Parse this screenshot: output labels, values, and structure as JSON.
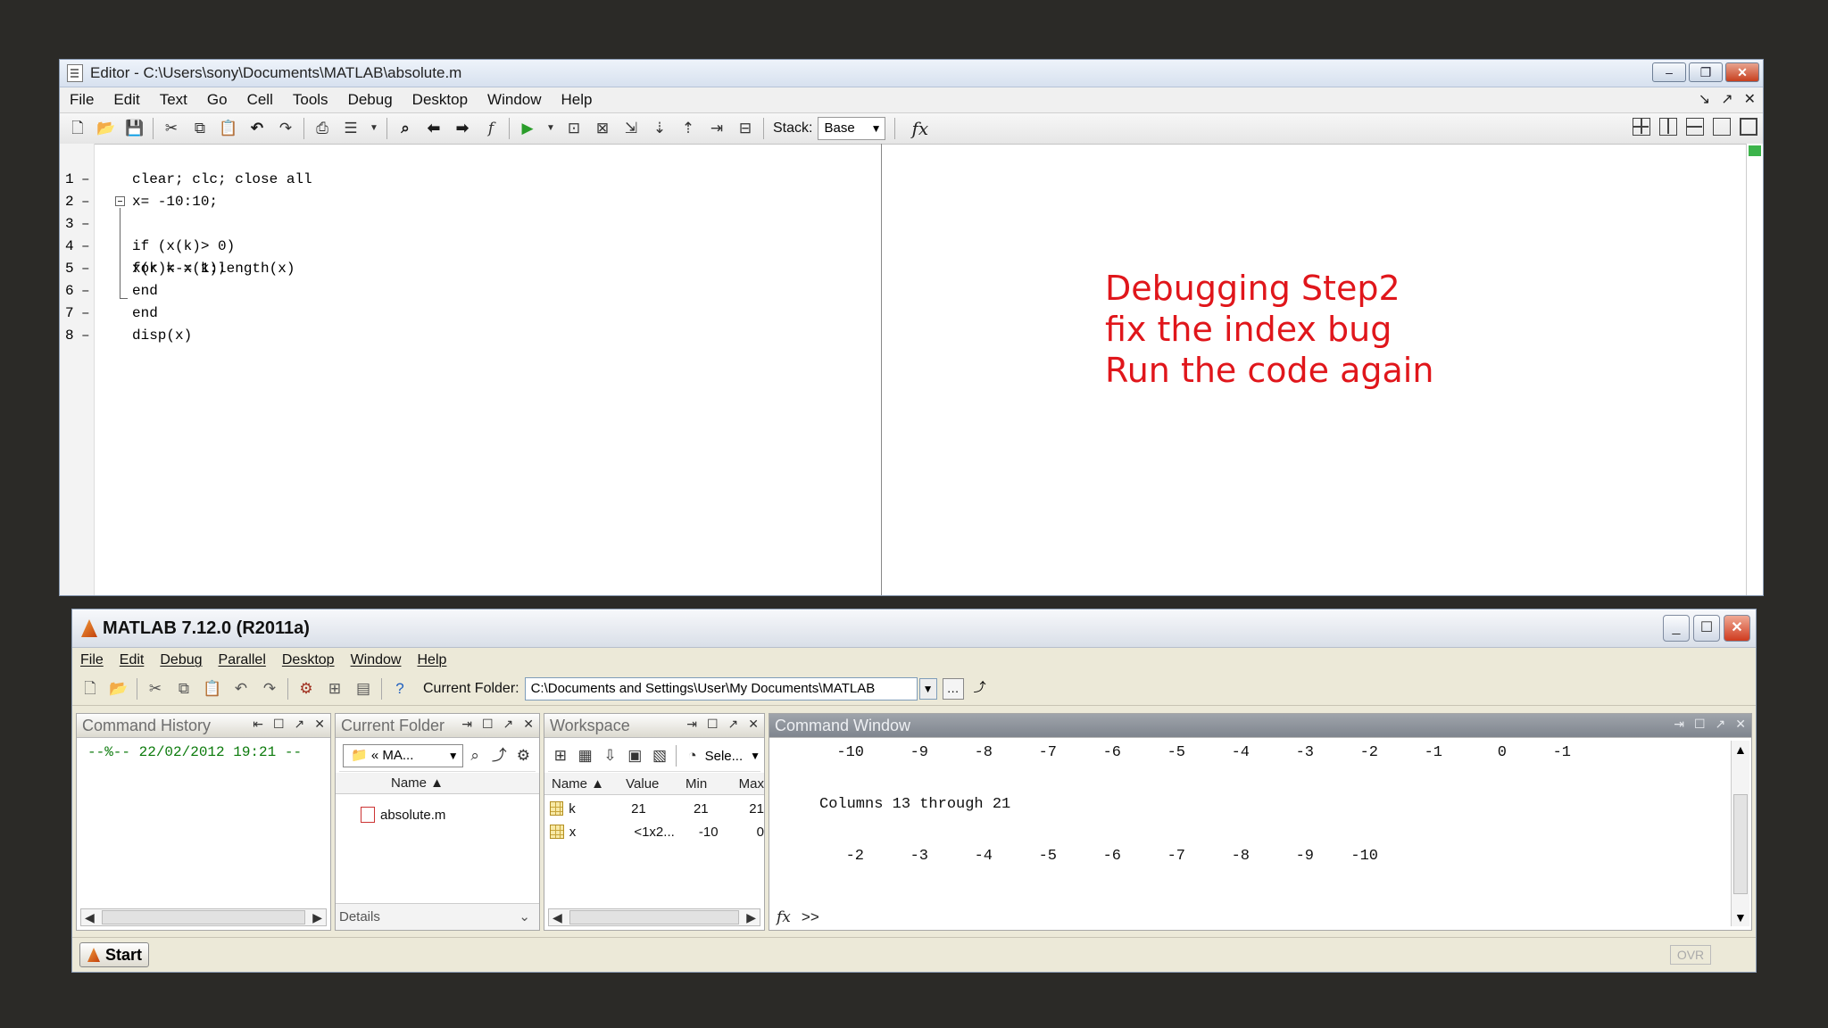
{
  "editor": {
    "title": "Editor - C:\\Users\\sony\\Documents\\MATLAB\\absolute.m",
    "menu": [
      "File",
      "Edit",
      "Text",
      "Go",
      "Cell",
      "Tools",
      "Debug",
      "Desktop",
      "Window",
      "Help"
    ],
    "stack_label": "Stack:",
    "stack_value": "Base",
    "fx_label": "fx",
    "lines": [
      {
        "num": "1",
        "code": "clear; clc; close all"
      },
      {
        "num": "2",
        "code": "x= -10:10;"
      },
      {
        "num": "3",
        "code": "for k = 1:length(x)"
      },
      {
        "num": "4",
        "code": "if (x(k)> 0)"
      },
      {
        "num": "5",
        "code": "x(k)=-x(k);"
      },
      {
        "num": "6",
        "code": "end"
      },
      {
        "num": "7",
        "code": "end"
      },
      {
        "num": "8",
        "code": "disp(x)"
      }
    ]
  },
  "annotation": [
    "Debugging Step2",
    "fix the index bug",
    "Run the code again"
  ],
  "matlab": {
    "title": "MATLAB  7.12.0 (R2011a)",
    "menu": [
      "File",
      "Edit",
      "Debug",
      "Parallel",
      "Desktop",
      "Window",
      "Help"
    ],
    "current_folder_label": "Current Folder:",
    "current_folder_path": "C:\\Documents and Settings\\User\\My Documents\\MATLAB",
    "panels": {
      "history": {
        "title": "Command History",
        "entry": "--%-- 22/02/2012 19:21 --"
      },
      "folder": {
        "title": "Current Folder",
        "combo": "« MA...",
        "col_name": "Name ▲",
        "file": "absolute.m",
        "details": "Details"
      },
      "workspace": {
        "title": "Workspace",
        "select": "Sele...",
        "headers": [
          "Name ▲",
          "Value",
          "Min",
          "Max"
        ],
        "rows": [
          {
            "name": "k",
            "value": "21",
            "min": "21",
            "max": "21"
          },
          {
            "name": "x",
            "value": "<1x2...",
            "min": "-10",
            "max": "0"
          }
        ]
      },
      "command": {
        "title": "Command Window",
        "row1": [
          "-10",
          "-9",
          "-8",
          "-7",
          "-6",
          "-5",
          "-4",
          "-3",
          "-2",
          "-1",
          "0",
          "-1"
        ],
        "columns_text": "Columns 13 through 21",
        "row2": [
          "-2",
          "-3",
          "-4",
          "-5",
          "-6",
          "-7",
          "-8",
          "-9",
          "-10"
        ],
        "prompt": ">>"
      }
    },
    "start_label": "Start",
    "ovr_label": "OVR"
  }
}
